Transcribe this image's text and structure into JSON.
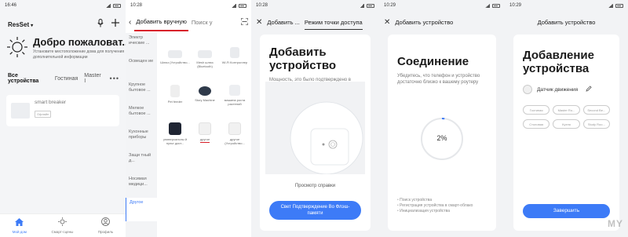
{
  "screen1": {
    "status": {
      "time": "16:46",
      "icons": "◦ ◦"
    },
    "home_name": "ResSet",
    "welcome_title": "Добро пожаловат...",
    "welcome_sub": "Установите местоположение дома для получения дополнительной информации",
    "tabs": [
      "Все устройства",
      "Гостиная",
      "Master I"
    ],
    "more": "•••",
    "device": {
      "name": "smart breaker",
      "status": "Офлайн"
    },
    "nav": [
      {
        "label": "Мой дом",
        "icon": "home-icon"
      },
      {
        "label": "Смарт-сцены",
        "icon": "sun-icon"
      },
      {
        "label": "Профиль",
        "icon": "profile-icon"
      }
    ]
  },
  "screen2": {
    "status": {
      "time": "10:28"
    },
    "tab_manual": "Добавить вручную",
    "tab_search": "Поиск у",
    "categories": [
      "Электр ические ...",
      "Освещен ие",
      "Крупное бытовое ...",
      "Мелкое бытовое ...",
      "Кухонные приборы",
      "Защи тный д...",
      "Носимая медици...",
      "Другое"
    ],
    "items": [
      {
        "label": "Шлюз (Устройство...",
        "tone": "#e9ebee"
      },
      {
        "label": "Mesh шлюз (Bluetooth)",
        "tone": "#e9ebee"
      },
      {
        "label": "Wi-Fi Контроллер",
        "tone": "#e9ebee"
      },
      {
        "label": "Pet feeder",
        "tone": "#eeeeee"
      },
      {
        "label": "Story Machine",
        "tone": "#2f3a4a"
      },
      {
        "label": "машина роста растений",
        "tone": "#eceef1"
      },
      {
        "label": "универсальны й пульт дист...",
        "tone": "#1f2533"
      },
      {
        "label": "другое",
        "tone": "#f1f1f1"
      },
      {
        "label": "другое (Устройство...",
        "tone": "#f1f1f1"
      }
    ]
  },
  "screen3": {
    "status": {
      "time": "10:28"
    },
    "header_title": "Добавить ...",
    "header_tab": "Режим точки доступа",
    "title": "Добавить устройство",
    "desc": "Мощность, это было подтверждено в импульсной лампы",
    "help": "Просмотр справки",
    "button": "Свет Подтверждение Во Флэш-памяти"
  },
  "screen4": {
    "status": {
      "time": "10:29"
    },
    "header_title": "Добавить устройство",
    "title": "Соединение",
    "desc": "Убедитесь, что телефон и устройство достаточно близко к вашему роутеру",
    "progress_text": "2%",
    "progress": 0.02,
    "steps": [
      "Поиск устройства",
      "Регистрация устройства в смарт-облако",
      "Инициализация устройства"
    ]
  },
  "screen5": {
    "status": {
      "time": "10:29"
    },
    "header_title": "Добавить устройство",
    "title": "Добавление устройства",
    "sensor_name": "Датчик движения",
    "rooms": [
      "Гостиная",
      "Master Ro...",
      "Second Be...",
      "Столовая",
      "Кухня",
      "Study Roo..."
    ],
    "button": "Завершить",
    "watermark": "MY"
  },
  "colors": {
    "accent": "#3d7bf7",
    "underline": "#d8202a"
  }
}
